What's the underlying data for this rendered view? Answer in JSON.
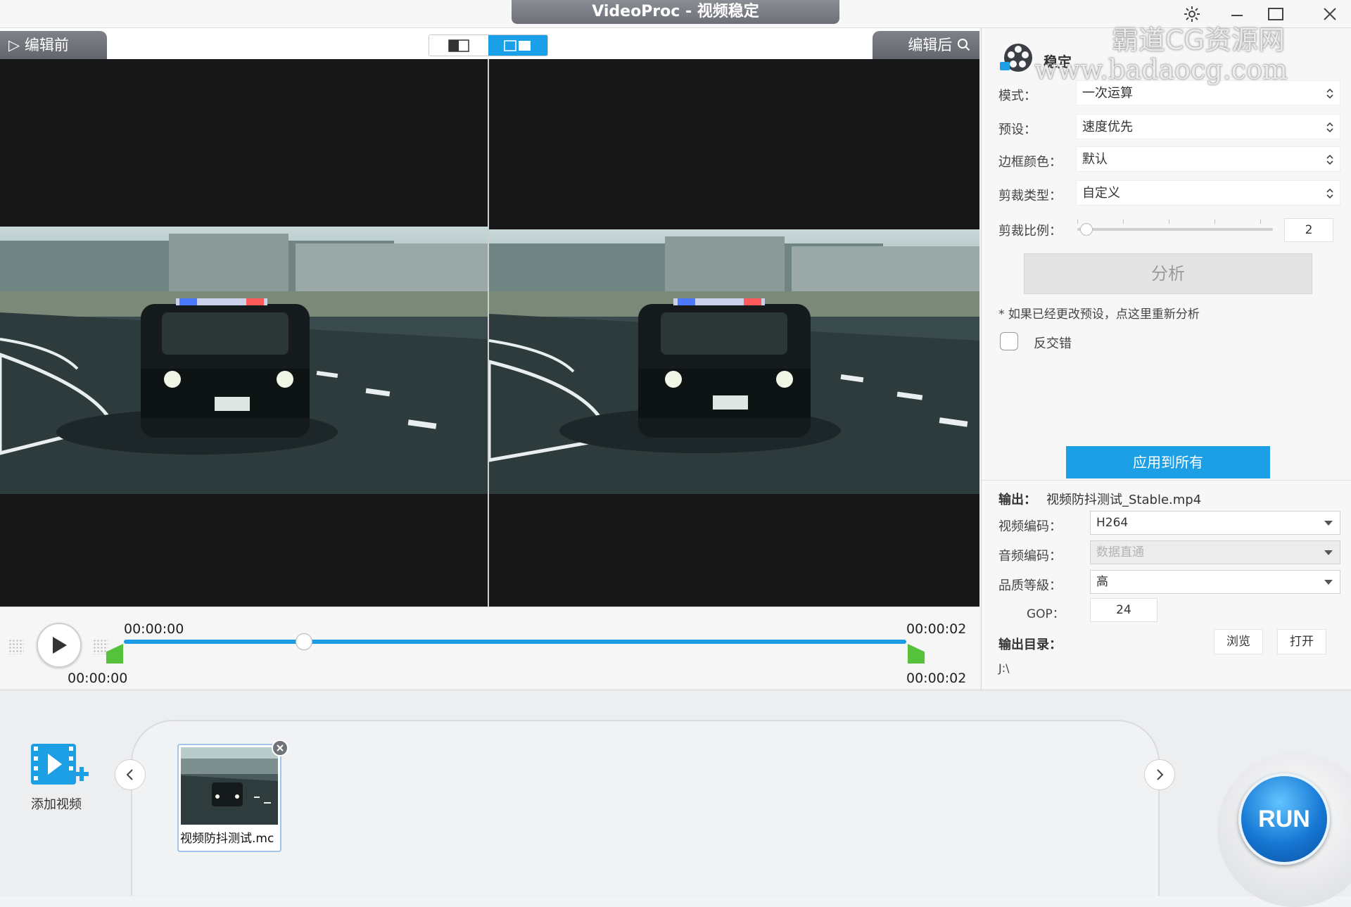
{
  "window": {
    "title": "VideoProc - 视频稳定",
    "controls": [
      "gear-icon",
      "minimize-icon",
      "maximize-icon",
      "close-icon"
    ]
  },
  "watermark": {
    "line1": "霸道CG资源网",
    "line2": "www.badaocg.com"
  },
  "preview": {
    "before_label": "编辑前",
    "after_label": "编辑后",
    "view_modes": [
      "single-view-icon",
      "split-view-icon"
    ],
    "active_view": "split-view-icon"
  },
  "timeline": {
    "start_top": "00:00:00",
    "end_top": "00:00:02",
    "start_bottom": "00:00:00",
    "end_bottom": "00:00:02",
    "seek_progress": 0.23
  },
  "stabilize": {
    "title": "稳定",
    "fields": [
      {
        "label": "模式：",
        "value": "一次运算"
      },
      {
        "label": "预设：",
        "value": "速度优先"
      },
      {
        "label": "边框颜色：",
        "value": "默认"
      },
      {
        "label": "剪裁类型：",
        "value": "自定义"
      }
    ],
    "crop_label": "剪裁比例：",
    "crop_value": "2",
    "analyze_label": "分析",
    "note": "* 如果已经更改预设，点这里重新分析",
    "deinterlace_label": "反交错",
    "deinterlace_checked": false,
    "apply_all_label": "应用到所有"
  },
  "output": {
    "label": "输出：",
    "filename": "视频防抖测试_Stable.mp4",
    "video_codec_label": "视频编码：",
    "video_codec": "H264",
    "audio_codec_label": "音频编码：",
    "audio_codec": "数据直通",
    "quality_label": "品质等級：",
    "quality": "高",
    "gop_label": "GOP：",
    "gop": "24",
    "dir_label": "输出目录：",
    "browse_label": "浏览",
    "open_label": "打开",
    "dir_path": "J:\\"
  },
  "bottom": {
    "add_video_label": "添加视频",
    "clip_name": "视频防抖测试.mc",
    "run_label": "RUN"
  },
  "colors": {
    "accent": "#1d9fe6",
    "trim_green": "#56c13a",
    "header_gray": "#6d7078"
  }
}
